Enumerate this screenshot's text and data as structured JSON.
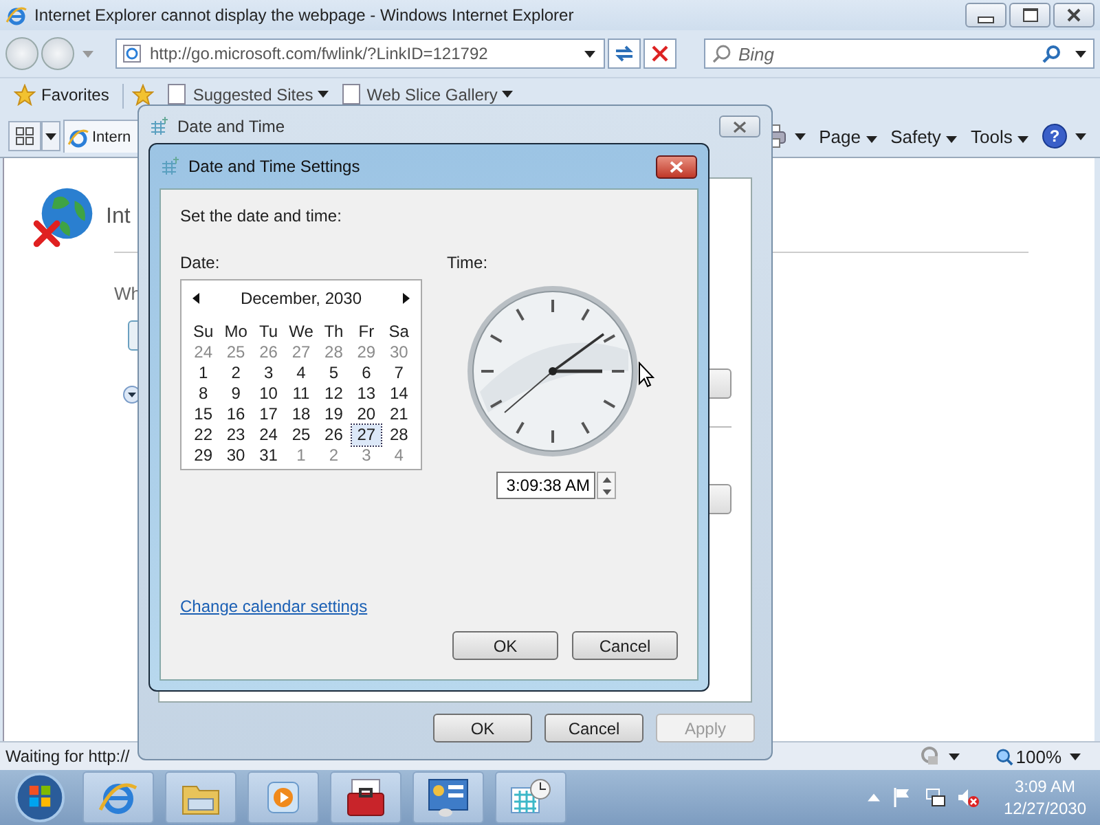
{
  "browser": {
    "title": "Internet Explorer cannot display the webpage - Windows Internet Explorer",
    "address": "http://go.microsoft.com/fwlink/?LinkID=121792",
    "search": {
      "placeholder": "Bing"
    },
    "favorites": "Favorites",
    "fav_links": [
      "Suggested Sites",
      "Web Slice Gallery"
    ],
    "tab": "Intern",
    "commands": [
      "Page",
      "Safety",
      "Tools"
    ],
    "help": "?",
    "page_heading": "Int",
    "page_text": "Wh",
    "status": "Waiting for http://",
    "zoom": "100%"
  },
  "outer_dialog": {
    "title": "Date and Time",
    "buttons": [
      {
        "label": "OK",
        "disabled": false
      },
      {
        "label": "Cancel",
        "disabled": false
      },
      {
        "label": "Apply",
        "disabled": true
      }
    ]
  },
  "dialog": {
    "title": "Date and Time Settings",
    "prompt": "Set the date and time:",
    "date_label": "Date:",
    "time_label": "Time:",
    "month": "December, 2030",
    "weekdays": [
      "Su",
      "Mo",
      "Tu",
      "We",
      "Th",
      "Fr",
      "Sa"
    ],
    "days": [
      {
        "label": "24",
        "other_month": true,
        "selected": false
      },
      {
        "label": "25",
        "other_month": true,
        "selected": false
      },
      {
        "label": "26",
        "other_month": true,
        "selected": false
      },
      {
        "label": "27",
        "other_month": true,
        "selected": false
      },
      {
        "label": "28",
        "other_month": true,
        "selected": false
      },
      {
        "label": "29",
        "other_month": true,
        "selected": false
      },
      {
        "label": "30",
        "other_month": true,
        "selected": false
      },
      {
        "label": "1",
        "other_month": false,
        "selected": false
      },
      {
        "label": "2",
        "other_month": false,
        "selected": false
      },
      {
        "label": "3",
        "other_month": false,
        "selected": false
      },
      {
        "label": "4",
        "other_month": false,
        "selected": false
      },
      {
        "label": "5",
        "other_month": false,
        "selected": false
      },
      {
        "label": "6",
        "other_month": false,
        "selected": false
      },
      {
        "label": "7",
        "other_month": false,
        "selected": false
      },
      {
        "label": "8",
        "other_month": false,
        "selected": false
      },
      {
        "label": "9",
        "other_month": false,
        "selected": false
      },
      {
        "label": "10",
        "other_month": false,
        "selected": false
      },
      {
        "label": "11",
        "other_month": false,
        "selected": false
      },
      {
        "label": "12",
        "other_month": false,
        "selected": false
      },
      {
        "label": "13",
        "other_month": false,
        "selected": false
      },
      {
        "label": "14",
        "other_month": false,
        "selected": false
      },
      {
        "label": "15",
        "other_month": false,
        "selected": false
      },
      {
        "label": "16",
        "other_month": false,
        "selected": false
      },
      {
        "label": "17",
        "other_month": false,
        "selected": false
      },
      {
        "label": "18",
        "other_month": false,
        "selected": false
      },
      {
        "label": "19",
        "other_month": false,
        "selected": false
      },
      {
        "label": "20",
        "other_month": false,
        "selected": false
      },
      {
        "label": "21",
        "other_month": false,
        "selected": false
      },
      {
        "label": "22",
        "other_month": false,
        "selected": false
      },
      {
        "label": "23",
        "other_month": false,
        "selected": false
      },
      {
        "label": "24",
        "other_month": false,
        "selected": false
      },
      {
        "label": "25",
        "other_month": false,
        "selected": false
      },
      {
        "label": "26",
        "other_month": false,
        "selected": false
      },
      {
        "label": "27",
        "other_month": false,
        "selected": true
      },
      {
        "label": "28",
        "other_month": false,
        "selected": false
      },
      {
        "label": "29",
        "other_month": false,
        "selected": false
      },
      {
        "label": "30",
        "other_month": false,
        "selected": false
      },
      {
        "label": "31",
        "other_month": false,
        "selected": false
      },
      {
        "label": "1",
        "other_month": true,
        "selected": false
      },
      {
        "label": "2",
        "other_month": true,
        "selected": false
      },
      {
        "label": "3",
        "other_month": true,
        "selected": false
      },
      {
        "label": "4",
        "other_month": true,
        "selected": false
      }
    ],
    "time": "3:09:38 AM",
    "link": "Change calendar settings",
    "buttons": [
      "OK",
      "Cancel"
    ]
  },
  "taskbar": {
    "time": "3:09 AM",
    "date": "12/27/2030"
  }
}
